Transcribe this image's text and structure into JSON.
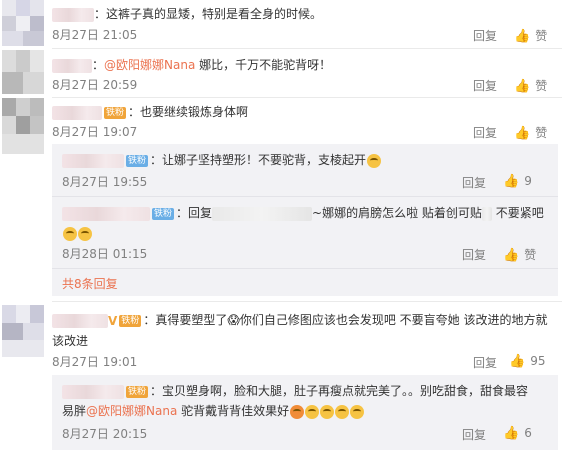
{
  "comments": [
    {
      "text": "：这裤子真的显矮，特别是看全身的时候。",
      "time": "8月27日 21:05",
      "reply": "回复",
      "like": "赞"
    },
    {
      "mention": "@欧阳娜娜Nana",
      "text": " 娜比，千万不能驼背呀！",
      "prefix": "：",
      "time": "8月27日 20:59",
      "reply": "回复",
      "like": "赞"
    },
    {
      "badge": "铁粉",
      "text": "：也要继续锻炼身体啊",
      "time": "8月27日 19:07",
      "reply": "回复",
      "like": "赞"
    },
    {
      "badge": "铁粉",
      "text": "：真得要塑型了😱你们自己修图应该也会发现吧 不要盲夸她 该改进的地方就",
      "text2": "该改进",
      "time": "8月27日 19:01",
      "reply": "回复",
      "like_count": "95"
    }
  ],
  "subreplies_a": [
    {
      "badge": "铁粉",
      "text": "：让娜子坚持塑形！不要驼背，支棱起开",
      "time": "8月27日 19:55",
      "reply": "回复",
      "like_count": "9"
    },
    {
      "badge": "铁粉",
      "text_a": "：回复",
      "text_b": "~娜娜的肩膀怎么啦 贴着创可贴",
      "text_c": " 不要紧吧",
      "time": "8月28日 01:15",
      "reply": "回复",
      "like": "赞"
    }
  ],
  "more_replies": "共8条回复",
  "subreplies_b": [
    {
      "badge": "铁粉",
      "text": "：宝贝塑身啊，脸和大腿，肚子再瘦点就完美了。。别吃甜食，甜食最容",
      "text2_a": "易胖",
      "mention": "@欧阳娜娜Nana",
      "text2_b": " 驼背戴背背佳效果好",
      "time": "8月27日 20:15",
      "reply": "回复",
      "like_count": "6"
    }
  ],
  "icons": {
    "like": "thumbs-up-icon"
  },
  "colors": {
    "mention": "#eb7350",
    "meta": "#808080",
    "subbox_bg": "#f2f2f5"
  }
}
